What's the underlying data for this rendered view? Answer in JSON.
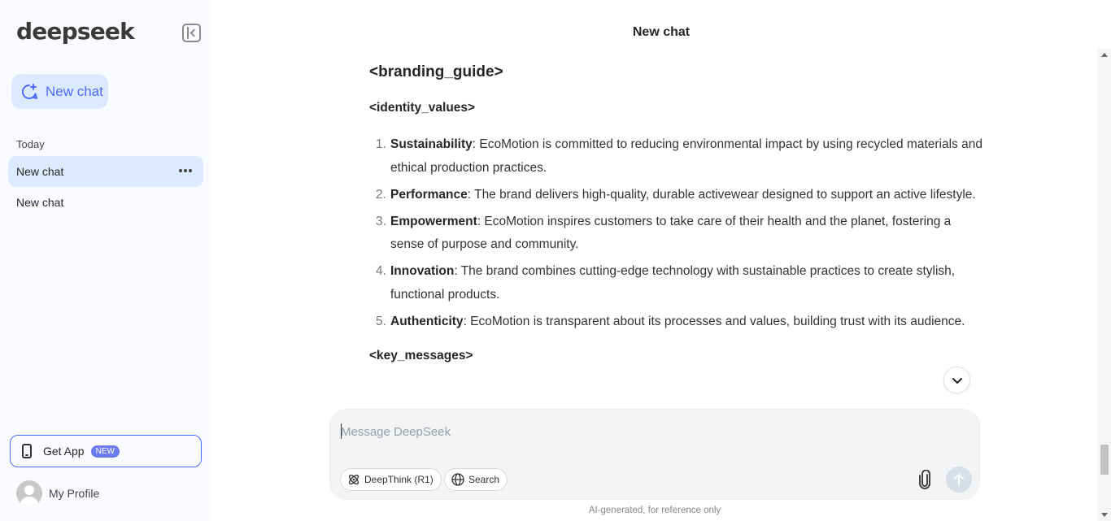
{
  "sidebar": {
    "logo": "deepseek",
    "new_chat_label": "New chat",
    "section_label": "Today",
    "chats": [
      {
        "title": "New chat",
        "active": true
      },
      {
        "title": "New chat",
        "active": false
      }
    ],
    "get_app_label": "Get App",
    "new_badge": "NEW",
    "profile_label": "My Profile"
  },
  "header": {
    "title": "New chat"
  },
  "message": {
    "heading": "<branding_guide>",
    "subheading": "<identity_values>",
    "values": [
      {
        "term": "Sustainability",
        "text": ": EcoMotion is committed to reducing environmental impact by using recycled materials and ethical production practices."
      },
      {
        "term": "Performance",
        "text": ": The brand delivers high-quality, durable activewear designed to support an active lifestyle."
      },
      {
        "term": "Empowerment",
        "text": ": EcoMotion inspires customers to take care of their health and the planet, fostering a sense of purpose and community."
      },
      {
        "term": "Innovation",
        "text": ": The brand combines cutting-edge technology with sustainable practices to create stylish, functional products."
      },
      {
        "term": "Authenticity",
        "text": ": EcoMotion is transparent about its processes and values, building trust with its audience."
      }
    ],
    "next_heading": "<key_messages>"
  },
  "composer": {
    "placeholder": "Message DeepSeek",
    "deepthink_label": "DeepThink (R1)",
    "search_label": "Search",
    "footer_note": "AI-generated, for reference only"
  },
  "colors": {
    "accent": "#4d6bfe",
    "sidebar_bg": "#f9fbff",
    "active_item_bg": "#dbeafe",
    "badge_bg": "#6b7cf0"
  }
}
